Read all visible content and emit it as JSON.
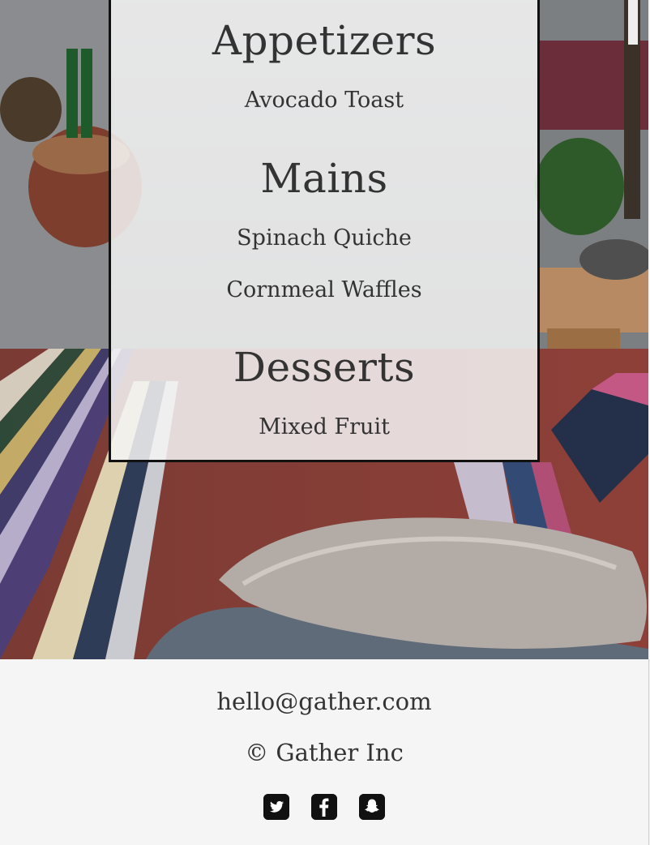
{
  "menu": {
    "sections": [
      {
        "title": "Appetizers",
        "items": [
          "Avocado Toast"
        ]
      },
      {
        "title": "Mains",
        "items": [
          "Spinach Quiche",
          "Cornmeal Waffles"
        ]
      },
      {
        "title": "Desserts",
        "items": [
          "Mixed Fruit"
        ]
      }
    ]
  },
  "footer": {
    "email": "hello@gather.com",
    "copyright": "© Gather Inc",
    "social": [
      {
        "name": "twitter-icon"
      },
      {
        "name": "facebook-icon"
      },
      {
        "name": "snapchat-icon"
      }
    ]
  },
  "colors": {
    "text": "#333333",
    "footer_bg": "#f5f5f5",
    "card_border": "#111111",
    "icon": "#111111"
  }
}
